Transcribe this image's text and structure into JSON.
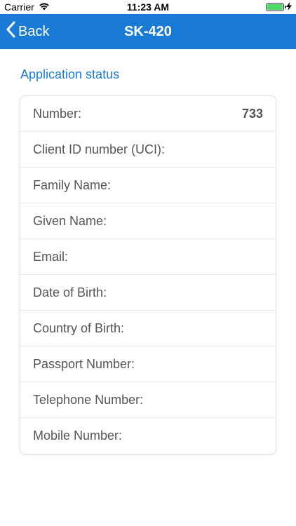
{
  "status_bar": {
    "carrier": "Carrier",
    "time": "11:23 AM",
    "battery_color": "#4cd964"
  },
  "nav": {
    "back_label": "Back",
    "title": "SK-420",
    "bar_color": "#1a7bd6"
  },
  "section": {
    "title": "Application status"
  },
  "fields": [
    {
      "label": "Number:",
      "value": "733"
    },
    {
      "label": "Client ID number (UCI):",
      "value": ""
    },
    {
      "label": "Family Name:",
      "value": ""
    },
    {
      "label": "Given Name:",
      "value": ""
    },
    {
      "label": "Email:",
      "value": ""
    },
    {
      "label": "Date of Birth:",
      "value": ""
    },
    {
      "label": "Country of Birth:",
      "value": ""
    },
    {
      "label": "Passport Number:",
      "value": ""
    },
    {
      "label": "Telephone Number:",
      "value": ""
    },
    {
      "label": "Mobile Number:",
      "value": ""
    }
  ]
}
